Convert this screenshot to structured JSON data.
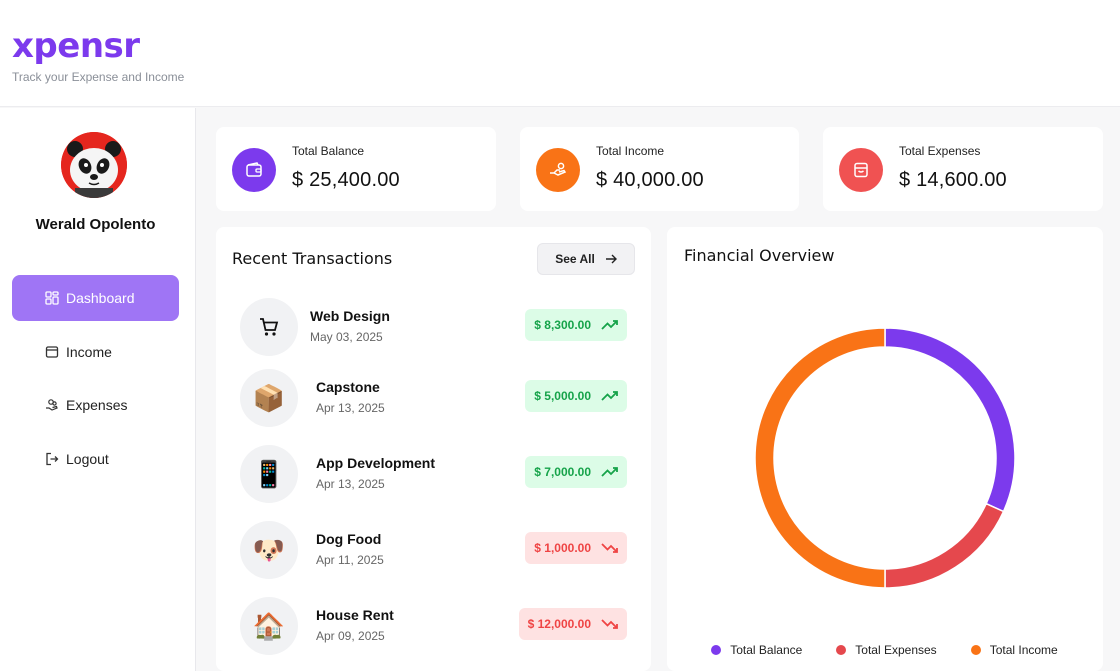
{
  "app": {
    "logo": "xpensr",
    "tagline": "Track your Expense and Income"
  },
  "user": {
    "name": "Werald Opolento"
  },
  "nav": [
    {
      "label": "Dashboard",
      "icon": "dashboard-grid-icon",
      "active": true
    },
    {
      "label": "Income",
      "icon": "income-card-icon",
      "active": false
    },
    {
      "label": "Expenses",
      "icon": "expenses-hand-icon",
      "active": false
    },
    {
      "label": "Logout",
      "icon": "logout-icon",
      "active": false
    }
  ],
  "stats": [
    {
      "title": "Total Balance",
      "value": "$ 25,400.00",
      "icon": "wallet-icon",
      "color": "#7c3aed"
    },
    {
      "title": "Total Income",
      "value": "$ 40,000.00",
      "icon": "hand-coin-icon",
      "color": "#f97316"
    },
    {
      "title": "Total Expenses",
      "value": "$ 14,600.00",
      "icon": "receipt-icon",
      "color": "#ef4444"
    }
  ],
  "transactions": {
    "title": "Recent Transactions",
    "see_all": "See All",
    "items": [
      {
        "name": "Web Design",
        "date": "May 03, 2025",
        "amount": "$ 8,300.00",
        "type": "income",
        "icon": "cart-icon"
      },
      {
        "name": "Capstone",
        "date": "Apr 13, 2025",
        "amount": "$ 5,000.00",
        "type": "income",
        "icon": "box-emoji",
        "emoji": "📦"
      },
      {
        "name": "App Development",
        "date": "Apr 13, 2025",
        "amount": "$ 7,000.00",
        "type": "income",
        "icon": "phone-emoji",
        "emoji": "📱"
      },
      {
        "name": "Dog Food",
        "date": "Apr 11, 2025",
        "amount": "$ 1,000.00",
        "type": "expense",
        "icon": "dog-emoji",
        "emoji": "🐶"
      },
      {
        "name": "House Rent",
        "date": "Apr 09, 2025",
        "amount": "$ 12,000.00",
        "type": "expense",
        "icon": "house-emoji",
        "emoji": "🏠"
      }
    ]
  },
  "overview": {
    "title": "Financial Overview",
    "legend": [
      {
        "label": "Total Balance",
        "color": "#7c3aed"
      },
      {
        "label": "Total Expenses",
        "color": "#e5484d"
      },
      {
        "label": "Total Income",
        "color": "#f97316"
      }
    ]
  },
  "chart_data": {
    "type": "pie",
    "categories": [
      "Total Balance",
      "Total Expenses",
      "Total Income"
    ],
    "values": [
      25400,
      14600,
      40000
    ],
    "colors": [
      "#7c3aed",
      "#e5484d",
      "#f97316"
    ],
    "title": "Financial Overview",
    "legend": "bottom"
  }
}
